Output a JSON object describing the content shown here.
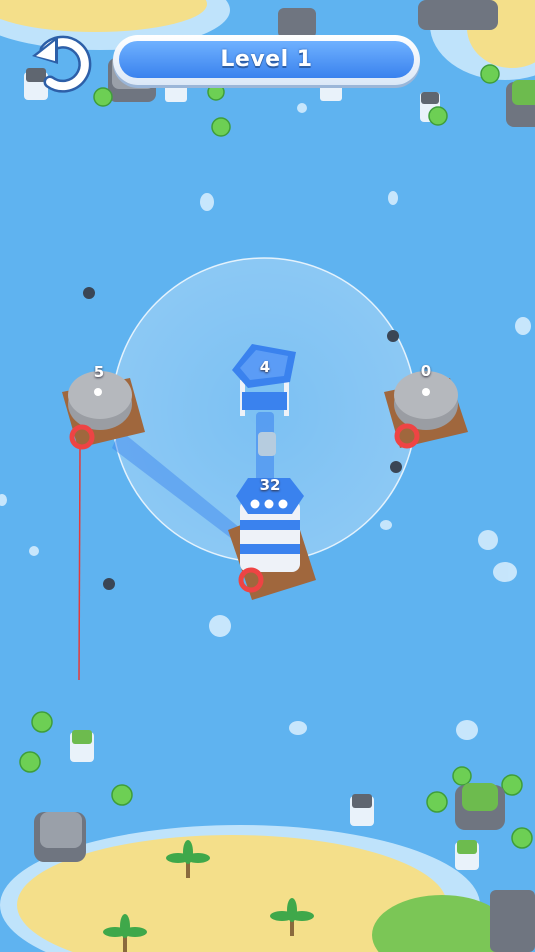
{
  "hud": {
    "level_label": "Level 1",
    "restart_icon": "restart-arrow-icon"
  },
  "towers": {
    "left_enemy": {
      "count": "5",
      "team": "neutral-gray"
    },
    "right_enemy": {
      "count": "0",
      "team": "neutral-gray"
    },
    "watchtower": {
      "count": "4",
      "team": "blue"
    },
    "player_main": {
      "count": "32",
      "team": "blue"
    }
  },
  "colors": {
    "water": "#5fb3f0",
    "sand": "#f4df8a",
    "player": "#3a82ee",
    "enemy": "#8e8e8e"
  }
}
